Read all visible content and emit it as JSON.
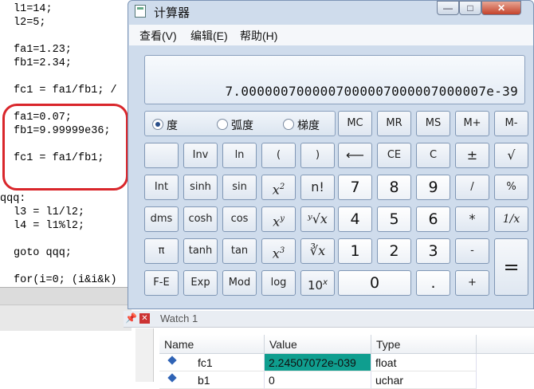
{
  "editor": {
    "lines": [
      "l1=14;",
      "l2=5;",
      "",
      "fa1=1.23;",
      "fb1=2.34;",
      "",
      "fc1 = fa1/fb1; /",
      "",
      "fa1=0.07;",
      "fb1=9.99999e36;",
      "",
      "fc1 = fa1/fb1;",
      "",
      "",
      "qqq:",
      "l3 = l1/l2;",
      "l4 = l1%l2;",
      "",
      "goto qqq;",
      "",
      "for(i=0; (i&i&k)"
    ]
  },
  "calculator": {
    "title": "计算器",
    "window_buttons": {
      "minimize": "—",
      "maximize": "□",
      "close": "✕"
    },
    "menu": [
      "查看(V)",
      "编辑(E)",
      "帮助(H)"
    ],
    "display": "7.0000007000007000007000007000007e-39",
    "angle_modes": [
      {
        "label": "度",
        "selected": true
      },
      {
        "label": "弧度",
        "selected": false
      },
      {
        "label": "梯度",
        "selected": false
      }
    ],
    "memory_keys": [
      "MC",
      "MR",
      "MS",
      "M+",
      "M-"
    ],
    "keys": {
      "blank": "",
      "inv": "Inv",
      "ln": "ln",
      "lparen": "(",
      "rparen": ")",
      "backspace": "⟵",
      "ce": "CE",
      "c": "C",
      "plusminus": "±",
      "sqrt": "√",
      "int": "Int",
      "sinh": "sinh",
      "sin": "sin",
      "x2_base": "x",
      "x2_exp": "2",
      "nfact": "n!",
      "n7": "7",
      "n8": "8",
      "n9": "9",
      "divide": "/",
      "percent": "%",
      "dms": "dms",
      "cosh": "cosh",
      "cos": "cos",
      "xy_base": "x",
      "xy_exp": "y",
      "yroot": "ʸ√x",
      "n4": "4",
      "n5": "5",
      "n6": "6",
      "multiply": "*",
      "reciprocal": "1/x",
      "pi": "π",
      "tanh": "tanh",
      "tan": "tan",
      "x3_base": "x",
      "x3_exp": "3",
      "cuberoot": "∛x",
      "n1": "1",
      "n2": "2",
      "n3": "3",
      "minus": "-",
      "equals": "=",
      "fe": "F-E",
      "exp": "Exp",
      "mod": "Mod",
      "log": "log",
      "tenx_base": "10",
      "tenx_exp": "x",
      "n0": "0",
      "decimal": ".",
      "plus": "+"
    }
  },
  "watch": {
    "title": "Watch 1",
    "headers": [
      "Name",
      "Value",
      "Type"
    ],
    "rows": [
      {
        "name": "fc1",
        "value": "2.24507072e-039",
        "type": "float",
        "highlight": "#0f9e8f"
      },
      {
        "name": "b1",
        "value": "0",
        "type": "uchar"
      }
    ]
  }
}
